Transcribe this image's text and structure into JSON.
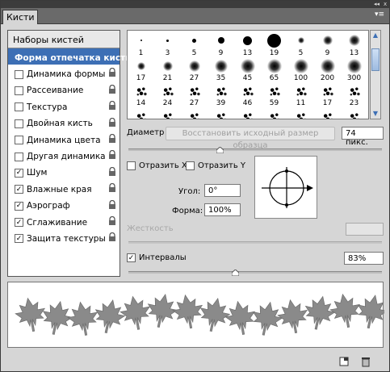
{
  "panel": {
    "tab_title": "Кисти",
    "window_buttons": [
      "◂◂",
      "x"
    ],
    "panel_menu": "▾≡"
  },
  "left": {
    "title": "Наборы кистей",
    "items": [
      {
        "label": "Форма отпечатка кисти",
        "checked": null,
        "selected": true,
        "lock": false
      },
      {
        "label": "Динамика формы",
        "checked": false,
        "lock": true
      },
      {
        "label": "Рассеивание",
        "checked": false,
        "lock": true
      },
      {
        "label": "Текстура",
        "checked": false,
        "lock": true
      },
      {
        "label": "Двойная кисть",
        "checked": false,
        "lock": true
      },
      {
        "label": "Динамика цвета",
        "checked": false,
        "lock": true
      },
      {
        "label": "Другая динамика",
        "checked": false,
        "lock": true
      },
      {
        "label": "Шум",
        "checked": true,
        "lock": true
      },
      {
        "label": "Влажные края",
        "checked": true,
        "lock": true
      },
      {
        "label": "Аэрограф",
        "checked": true,
        "lock": true
      },
      {
        "label": "Сглаживание",
        "checked": true,
        "lock": true
      },
      {
        "label": "Защита текстуры",
        "checked": true,
        "lock": true
      }
    ]
  },
  "brush_tips": {
    "row1": [
      "1",
      "3",
      "5",
      "9",
      "13",
      "19",
      "5",
      "9",
      "13"
    ],
    "row2": [
      "17",
      "21",
      "27",
      "35",
      "45",
      "65",
      "100",
      "200",
      "300"
    ],
    "row3": [
      "14",
      "24",
      "27",
      "39",
      "46",
      "59",
      "11",
      "17",
      "23"
    ]
  },
  "diameter": {
    "label": "Диаметр",
    "restore_label": "Восстановить исходный размер образца",
    "value": "74 пикс.",
    "slider_fraction": 0.36
  },
  "flip": {
    "x_label": "Отразить X",
    "y_label": "Отразить Y",
    "x_checked": false,
    "y_checked": false
  },
  "angle": {
    "label": "Угол:",
    "value": "0°"
  },
  "roundness": {
    "label": "Форма:",
    "value": "100%"
  },
  "hardness": {
    "label": "Жесткость",
    "value": ""
  },
  "spacing": {
    "label": "Интервалы",
    "checked": true,
    "value": "83%",
    "slider_fraction": 0.42
  },
  "icons": {
    "new": "new-brush-icon",
    "delete": "trash-icon"
  }
}
